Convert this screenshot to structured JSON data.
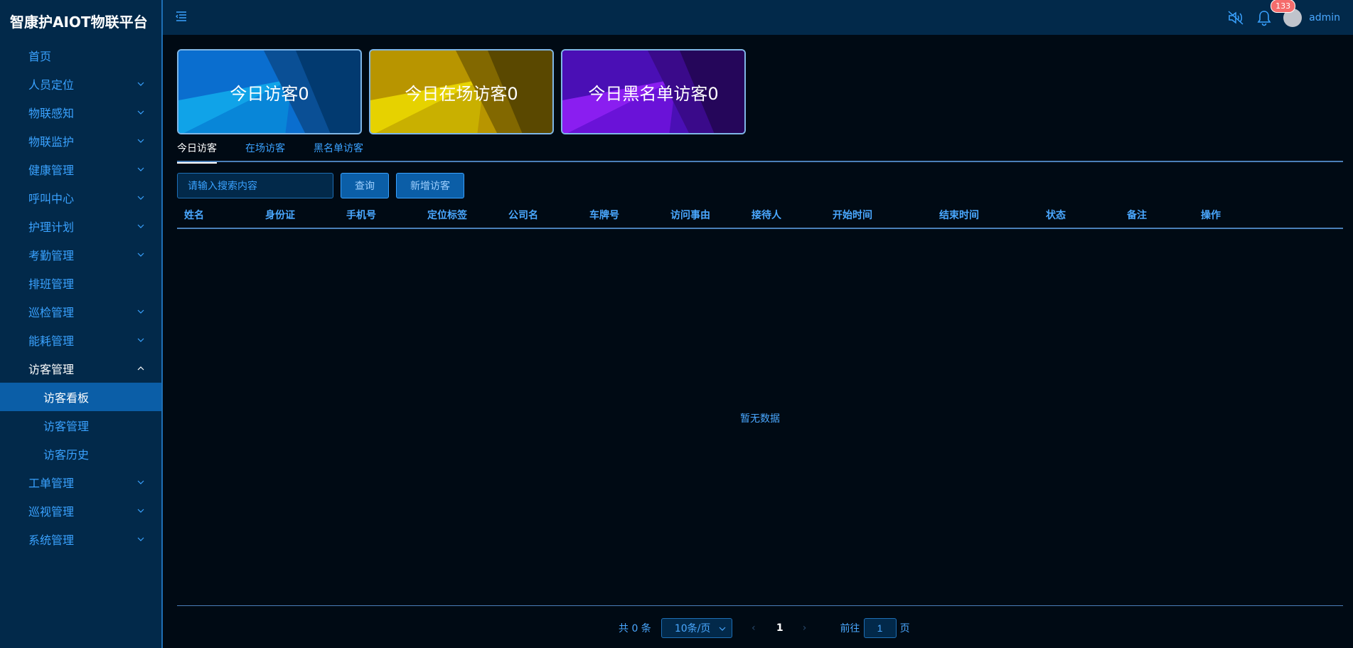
{
  "app": {
    "title": "智康护AIOT物联平台"
  },
  "sidebar": {
    "items": [
      {
        "label": "首页",
        "has_children": false
      },
      {
        "label": "人员定位",
        "has_children": true
      },
      {
        "label": "物联感知",
        "has_children": true
      },
      {
        "label": "物联监护",
        "has_children": true
      },
      {
        "label": "健康管理",
        "has_children": true
      },
      {
        "label": "呼叫中心",
        "has_children": true
      },
      {
        "label": "护理计划",
        "has_children": true
      },
      {
        "label": "考勤管理",
        "has_children": true
      },
      {
        "label": "排班管理",
        "has_children": false
      },
      {
        "label": "巡检管理",
        "has_children": true
      },
      {
        "label": "能耗管理",
        "has_children": true
      },
      {
        "label": "访客管理",
        "has_children": true,
        "expanded": true
      },
      {
        "label": "工单管理",
        "has_children": true
      },
      {
        "label": "巡视管理",
        "has_children": true
      },
      {
        "label": "系统管理",
        "has_children": true
      }
    ],
    "sub_items": [
      {
        "label": "访客看板",
        "active": true
      },
      {
        "label": "访客管理",
        "active": false
      },
      {
        "label": "访客历史",
        "active": false
      }
    ]
  },
  "header": {
    "notification_count": "133",
    "username": "admin",
    "icons": [
      "menu-collapse-icon",
      "speaker-mute-icon",
      "bell-icon"
    ]
  },
  "cards": [
    {
      "label": "今日访客0",
      "color": "#0a6ecf"
    },
    {
      "label": "今日在场访客0",
      "color": "#c9a800"
    },
    {
      "label": "今日黑名单访客0",
      "color": "#6a17e0"
    }
  ],
  "tabs": [
    {
      "label": "今日访客",
      "active": true
    },
    {
      "label": "在场访客",
      "active": false
    },
    {
      "label": "黑名单访客",
      "active": false
    }
  ],
  "toolbar": {
    "search_placeholder": "请输入搜索内容",
    "query_label": "查询",
    "add_label": "新增访客"
  },
  "table": {
    "columns": [
      "姓名",
      "身份证",
      "手机号",
      "定位标签",
      "公司名",
      "车牌号",
      "访问事由",
      "接待人",
      "开始时间",
      "结束时间",
      "状态",
      "备注",
      "操作"
    ],
    "rows": [],
    "empty_text": "暂无数据"
  },
  "pagination": {
    "total_text": "共 0 条",
    "page_size": "10条/页",
    "current_page": "1",
    "goto_prefix": "前往",
    "goto_value": "1",
    "goto_suffix": "页"
  }
}
